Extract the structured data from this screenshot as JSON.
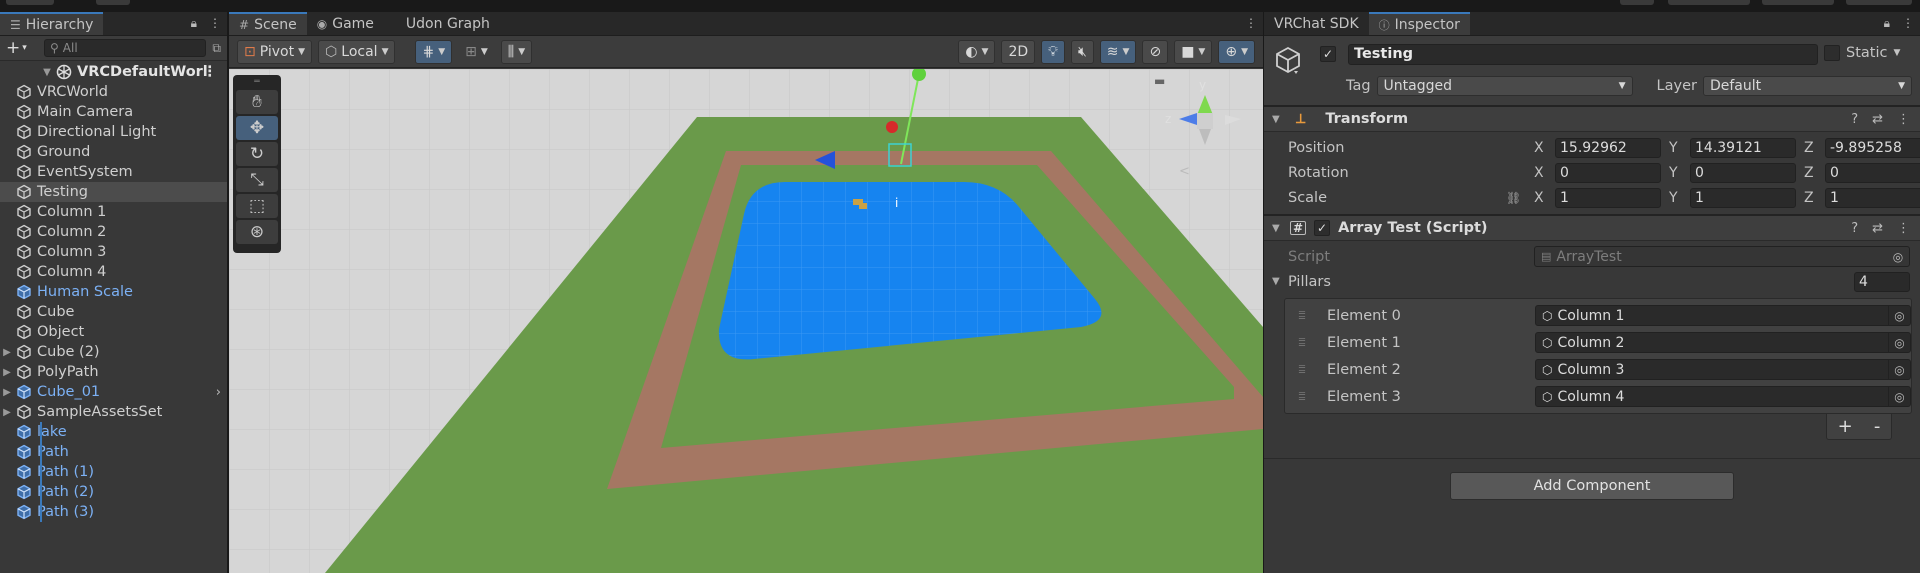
{
  "hierarchy": {
    "tab_label": "Hierarchy",
    "search_placeholder": "All",
    "scene_name": "VRCDefaultWorl",
    "items": [
      {
        "label": "VRCWorld",
        "prefab": false,
        "expand": false
      },
      {
        "label": "Main Camera",
        "prefab": false,
        "expand": false
      },
      {
        "label": "Directional Light",
        "prefab": false,
        "expand": false
      },
      {
        "label": "Ground",
        "prefab": false,
        "expand": false
      },
      {
        "label": "EventSystem",
        "prefab": false,
        "expand": false
      },
      {
        "label": "Testing",
        "prefab": false,
        "expand": false,
        "selected": true
      },
      {
        "label": "Column 1",
        "prefab": false,
        "expand": false
      },
      {
        "label": "Column 2",
        "prefab": false,
        "expand": false
      },
      {
        "label": "Column 3",
        "prefab": false,
        "expand": false
      },
      {
        "label": "Column 4",
        "prefab": false,
        "expand": false
      },
      {
        "label": "Human Scale",
        "prefab": true,
        "expand": false
      },
      {
        "label": "Cube",
        "prefab": false,
        "expand": false
      },
      {
        "label": "Object",
        "prefab": false,
        "expand": false
      },
      {
        "label": "Cube (2)",
        "prefab": false,
        "expand": true
      },
      {
        "label": "PolyPath",
        "prefab": false,
        "expand": true
      },
      {
        "label": "Cube_01",
        "prefab": true,
        "expand": true,
        "open_right": true
      },
      {
        "label": "SampleAssetsSet",
        "prefab": false,
        "expand": true
      },
      {
        "label": "lake",
        "prefab": true,
        "expand": false,
        "guide": true
      },
      {
        "label": "Path",
        "prefab": true,
        "expand": false,
        "guide": true
      },
      {
        "label": "Path (1)",
        "prefab": true,
        "expand": false,
        "guide": true
      },
      {
        "label": "Path (2)",
        "prefab": true,
        "expand": false,
        "guide": true
      },
      {
        "label": "Path (3)",
        "prefab": true,
        "expand": false,
        "guide": true
      }
    ]
  },
  "scene": {
    "tabs": [
      "Scene",
      "Game",
      "Udon Graph"
    ],
    "toolbar": {
      "pivot": "Pivot",
      "local": "Local",
      "mode_2d": "2D"
    },
    "gizmo_axes": {
      "x": "x",
      "y": "y",
      "z": "z"
    }
  },
  "inspector": {
    "tabs": [
      "VRChat SDK",
      "Inspector"
    ],
    "object_name": "Testing",
    "static_label": "Static",
    "tag_label": "Tag",
    "tag_value": "Untagged",
    "layer_label": "Layer",
    "layer_value": "Default",
    "transform": {
      "title": "Transform",
      "position_label": "Position",
      "rotation_label": "Rotation",
      "scale_label": "Scale",
      "position": {
        "x": "15.92962",
        "y": "14.39121",
        "z": "-9.895258"
      },
      "rotation": {
        "x": "0",
        "y": "0",
        "z": "0"
      },
      "scale": {
        "x": "1",
        "y": "1",
        "z": "1"
      }
    },
    "script_comp": {
      "title": "Array Test (Script)",
      "script_label": "Script",
      "script_value": "ArrayTest",
      "array_label": "Pillars",
      "array_size": "4",
      "elements": [
        {
          "label": "Element 0",
          "value": "Column 1"
        },
        {
          "label": "Element 1",
          "value": "Column 2"
        },
        {
          "label": "Element 2",
          "value": "Column 3"
        },
        {
          "label": "Element 3",
          "value": "Column 4"
        }
      ],
      "add_label": "+",
      "remove_label": "-"
    },
    "add_component": "Add Component"
  }
}
